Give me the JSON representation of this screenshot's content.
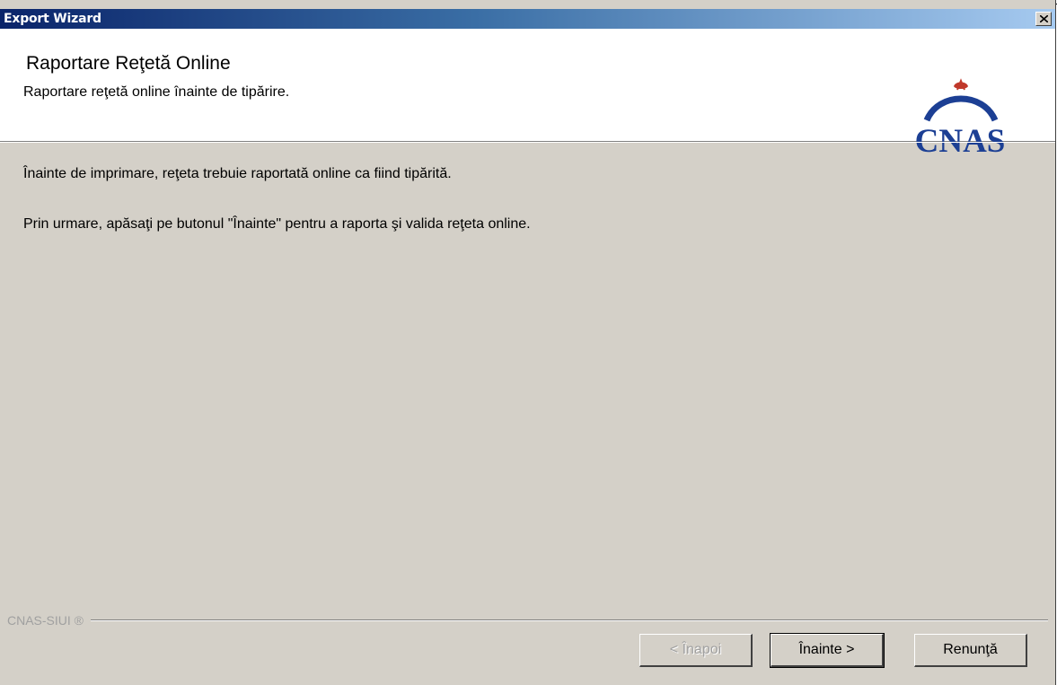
{
  "window": {
    "title": "Export Wizard"
  },
  "header": {
    "title": "Raportare Reţetă Online",
    "subtitle": "Raportare reţetă online înainte de tipărire.",
    "logo_text": "CNAS",
    "logo_color": "#1c3f94",
    "logo_accent": "#c0392b"
  },
  "body": {
    "line1": "Înainte de imprimare, reţeta trebuie raportată online ca fiind tipărită.",
    "line2": "Prin urmare, apăsaţi pe butonul \"Înainte\" pentru a raporta şi valida reţeta online."
  },
  "footer": {
    "brand": "CNAS-SIUI ®"
  },
  "buttons": {
    "back": "< Înapoi",
    "next": "Înainte >",
    "cancel": "Renunţă"
  }
}
